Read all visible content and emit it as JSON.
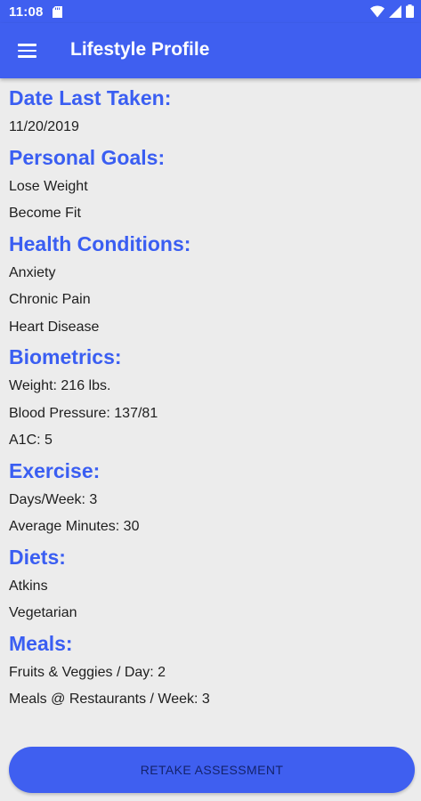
{
  "status_bar": {
    "time": "11:08"
  },
  "app_bar": {
    "title": "Lifestyle Profile"
  },
  "sections": [
    {
      "title": "Date Last Taken:",
      "items": [
        "11/20/2019"
      ]
    },
    {
      "title": "Personal Goals:",
      "items": [
        "Lose Weight",
        "Become Fit"
      ]
    },
    {
      "title": "Health Conditions:",
      "items": [
        "Anxiety",
        "Chronic Pain",
        "Heart Disease"
      ]
    },
    {
      "title": "Biometrics:",
      "items": [
        "Weight: 216 lbs.",
        "Blood Pressure: 137/81",
        "A1C: 5"
      ]
    },
    {
      "title": "Exercise:",
      "items": [
        "Days/Week: 3",
        "Average Minutes: 30"
      ]
    },
    {
      "title": "Diets:",
      "items": [
        "Atkins",
        "Vegetarian"
      ]
    },
    {
      "title": "Meals:",
      "items": [
        "Fruits & Veggies / Day: 2",
        "Meals @ Restaurants / Week: 3"
      ]
    }
  ],
  "retake_button": {
    "label": "RETAKE ASSESSMENT"
  },
  "colors": {
    "primary": "#3f5ff0",
    "heading": "#3a5ef2",
    "background": "#ececec"
  },
  "icons": [
    "sd-card-icon",
    "wifi-icon",
    "cell-signal-icon",
    "battery-icon",
    "menu-icon"
  ]
}
